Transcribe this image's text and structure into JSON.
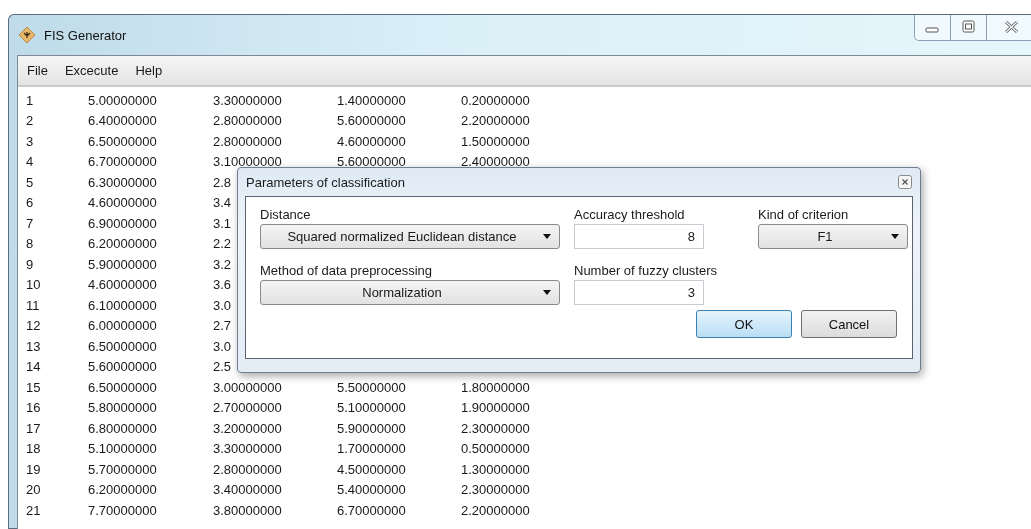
{
  "window": {
    "title": "FIS Generator"
  },
  "menu": [
    "File",
    "Excecute",
    "Help"
  ],
  "table": {
    "rows": [
      {
        "values": [
          "1",
          "5.00000000",
          "3.30000000",
          "1.40000000",
          "0.20000000"
        ]
      },
      {
        "values": [
          "2",
          "6.40000000",
          "2.80000000",
          "5.60000000",
          "2.20000000"
        ]
      },
      {
        "values": [
          "3",
          "6.50000000",
          "2.80000000",
          "4.60000000",
          "1.50000000"
        ]
      },
      {
        "values": [
          "4",
          "6.70000000",
          "3.10000000",
          "5.60000000",
          "2.40000000"
        ]
      },
      {
        "values": [
          "5",
          "6.30000000",
          "2.8"
        ]
      },
      {
        "values": [
          "6",
          "4.60000000",
          "3.4"
        ]
      },
      {
        "values": [
          "7",
          "6.90000000",
          "3.1"
        ]
      },
      {
        "values": [
          "8",
          "6.20000000",
          "2.2"
        ]
      },
      {
        "values": [
          "9",
          "5.90000000",
          "3.2"
        ]
      },
      {
        "values": [
          "10",
          "4.60000000",
          "3.6"
        ]
      },
      {
        "values": [
          "11",
          "6.10000000",
          "3.0"
        ]
      },
      {
        "values": [
          "12",
          "6.00000000",
          "2.7"
        ]
      },
      {
        "values": [
          "13",
          "6.50000000",
          "3.0"
        ]
      },
      {
        "values": [
          "14",
          "5.60000000",
          "2.5"
        ]
      },
      {
        "values": [
          "15",
          "6.50000000",
          "3.00000000",
          "5.50000000",
          "1.80000000"
        ]
      },
      {
        "values": [
          "16",
          "5.80000000",
          "2.70000000",
          "5.10000000",
          "1.90000000"
        ]
      },
      {
        "values": [
          "17",
          "6.80000000",
          "3.20000000",
          "5.90000000",
          "2.30000000"
        ]
      },
      {
        "values": [
          "18",
          "5.10000000",
          "3.30000000",
          "1.70000000",
          "0.50000000"
        ]
      },
      {
        "values": [
          "19",
          "5.70000000",
          "2.80000000",
          "4.50000000",
          "1.30000000"
        ]
      },
      {
        "values": [
          "20",
          "6.20000000",
          "3.40000000",
          "5.40000000",
          "2.30000000"
        ]
      },
      {
        "values": [
          "21",
          "7.70000000",
          "3.80000000",
          "6.70000000",
          "2.20000000"
        ]
      }
    ]
  },
  "dialog": {
    "title": "Parameters of classification",
    "fields": [
      {
        "kind": "dropdown",
        "label": "Distance",
        "value": "Squared normalized Euclidean distance"
      },
      {
        "kind": "input",
        "label": "Accuracy threshold",
        "value": "8"
      },
      {
        "kind": "dropdown",
        "label": "Kind of criterion",
        "value": "F1"
      },
      {
        "kind": "dropdown",
        "label": "Method of data preprocessing",
        "value": "Normalization"
      },
      {
        "kind": "input",
        "label": "Number of fuzzy clusters",
        "value": "3"
      }
    ],
    "buttons": [
      {
        "label": "OK",
        "default": true
      },
      {
        "label": "Cancel",
        "default": false
      }
    ]
  }
}
